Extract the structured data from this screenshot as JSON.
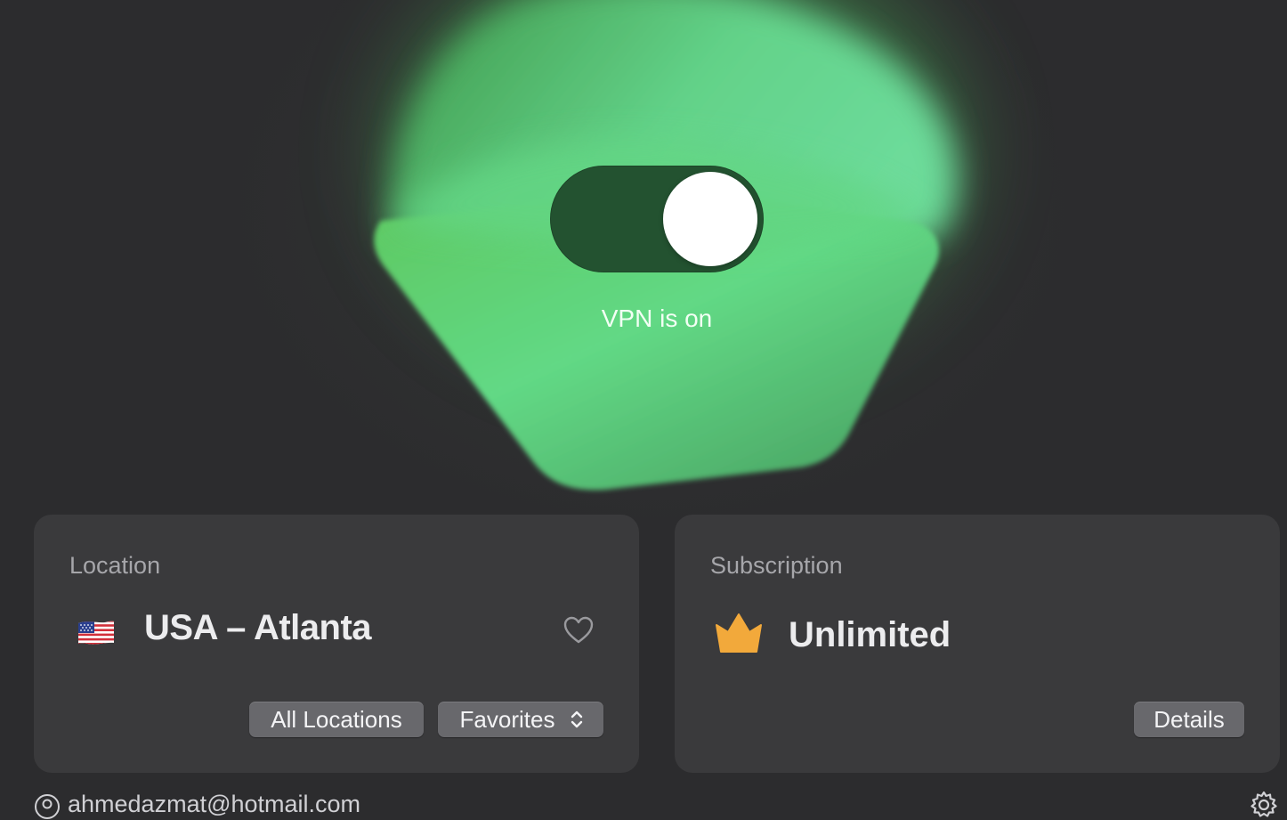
{
  "vpn": {
    "status_text": "VPN is on",
    "enabled": true
  },
  "location_card": {
    "label": "Location",
    "flag_icon": "us-flag-icon",
    "location_name": "USA – Atlanta",
    "favorite_icon": "heart-outline-icon",
    "all_locations_label": "All Locations",
    "favorites_label": "Favorites"
  },
  "subscription_card": {
    "label": "Subscription",
    "plan_icon": "crown-icon",
    "plan_name": "Unlimited",
    "details_label": "Details"
  },
  "footer": {
    "account_icon": "account-icon",
    "email": "ahmedazmat@hotmail.com",
    "settings_icon": "gear-icon"
  },
  "colors": {
    "background": "#2c2c2e",
    "card": "#3a3a3c",
    "toggle_track": "#235230",
    "glow_green": "#5fd77a",
    "crown": "#f2a93b"
  }
}
